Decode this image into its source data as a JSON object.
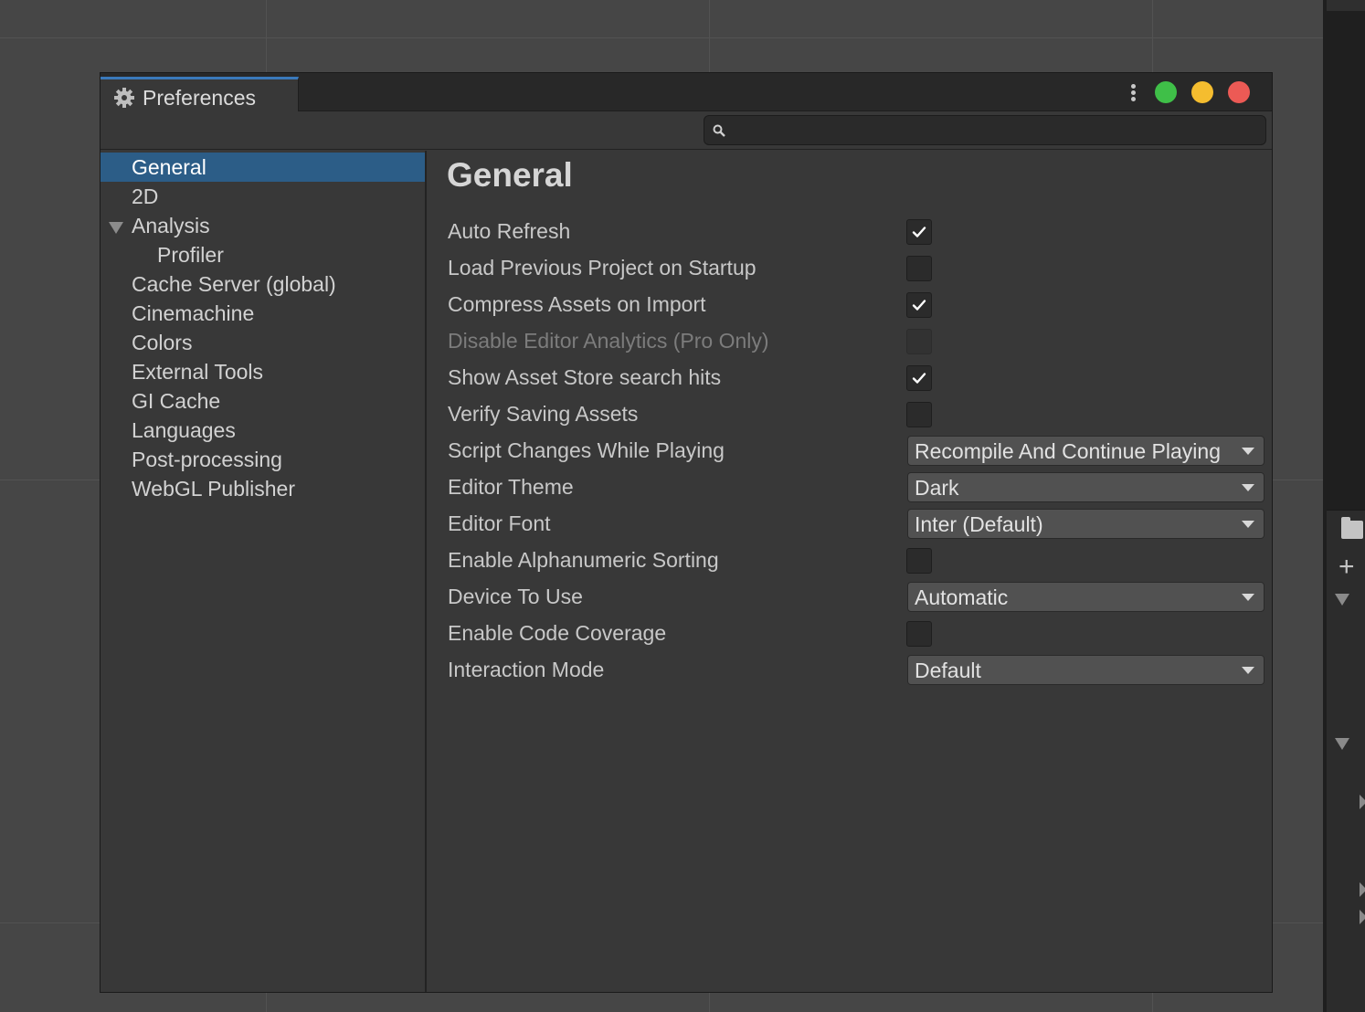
{
  "window": {
    "title": "Preferences",
    "title_icon": "gear-icon",
    "controls": {
      "menu_icon": "kebab-menu-icon",
      "colors": {
        "maximize": "#3fbf48",
        "minimize": "#f5bd2f",
        "close": "#ec5a55"
      }
    }
  },
  "search": {
    "placeholder": "",
    "value": "",
    "icon": "search-icon"
  },
  "sidebar": {
    "items": [
      {
        "label": "General",
        "selected": true
      },
      {
        "label": "2D"
      },
      {
        "label": "Analysis",
        "expanded": true
      },
      {
        "label": "Profiler",
        "child": true
      },
      {
        "label": "Cache Server (global)"
      },
      {
        "label": "Cinemachine"
      },
      {
        "label": "Colors"
      },
      {
        "label": "External Tools"
      },
      {
        "label": "GI Cache"
      },
      {
        "label": "Languages"
      },
      {
        "label": "Post-processing"
      },
      {
        "label": "WebGL Publisher"
      }
    ]
  },
  "main": {
    "heading": "General",
    "settings": [
      {
        "label": "Auto Refresh",
        "type": "checkbox",
        "checked": true
      },
      {
        "label": "Load Previous Project on Startup",
        "type": "checkbox",
        "checked": false
      },
      {
        "label": "Compress Assets on Import",
        "type": "checkbox",
        "checked": true
      },
      {
        "label": "Disable Editor Analytics (Pro Only)",
        "type": "checkbox",
        "checked": false,
        "disabled": true
      },
      {
        "label": "Show Asset Store search hits",
        "type": "checkbox",
        "checked": true
      },
      {
        "label": "Verify Saving Assets",
        "type": "checkbox",
        "checked": false
      },
      {
        "label": "Script Changes While Playing",
        "type": "dropdown",
        "value": "Recompile And Continue Playing"
      },
      {
        "label": "Editor Theme",
        "type": "dropdown",
        "value": "Dark"
      },
      {
        "label": "Editor Font",
        "type": "dropdown",
        "value": "Inter (Default)"
      },
      {
        "label": "Enable Alphanumeric Sorting",
        "type": "checkbox",
        "checked": false
      },
      {
        "label": "Device To Use",
        "type": "dropdown",
        "value": "Automatic"
      },
      {
        "label": "Enable Code Coverage",
        "type": "checkbox",
        "checked": false
      },
      {
        "label": "Interaction Mode",
        "type": "dropdown",
        "value": "Default"
      }
    ]
  },
  "colors": {
    "accent": "#3a79bb",
    "selection": "#2c5d87",
    "panel": "#383838",
    "background": "#464646"
  }
}
